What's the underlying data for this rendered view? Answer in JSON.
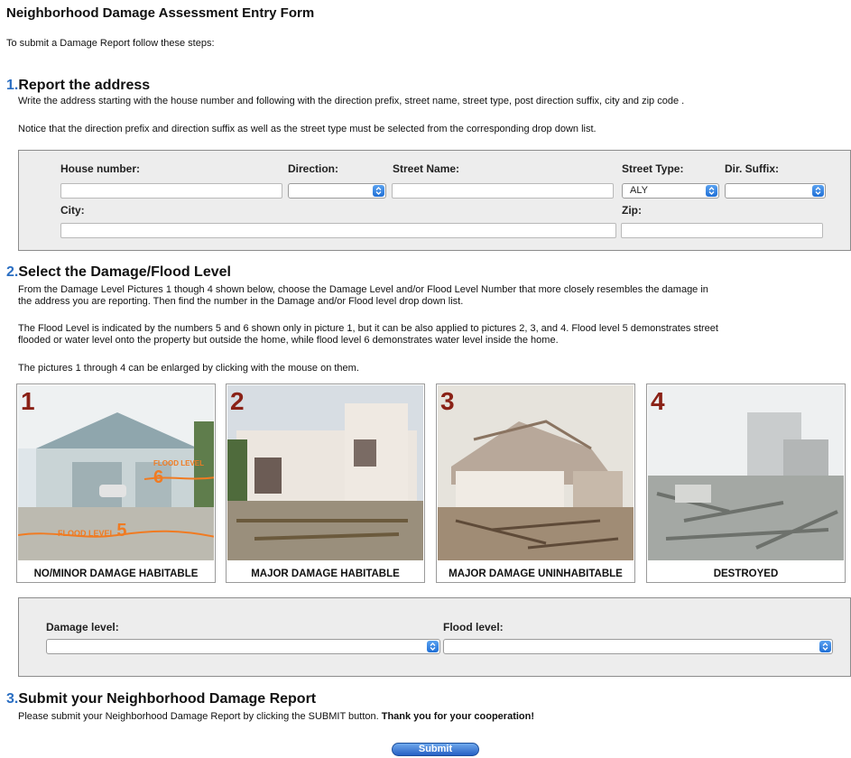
{
  "page_title": "Neighborhood Damage Assessment Entry Form",
  "intro": "To submit a Damage Report follow these steps:",
  "step1": {
    "number": "1.",
    "title": "Report the address",
    "text1": "Write the address starting with the house number and following with the direction prefix, street name, street type, post direction suffix, city and zip code .",
    "text2": "Notice that the direction prefix and direction suffix as well as the street type must be selected from the corresponding drop down list.",
    "fields": {
      "house_number": "House number:",
      "direction": "Direction:",
      "street_name": "Street Name:",
      "street_type": "Street Type:",
      "street_type_value": "ALY",
      "dir_suffix": "Dir. Suffix:",
      "city": "City:",
      "zip": "Zip:"
    }
  },
  "step2": {
    "number": "2.",
    "title": "Select the Damage/Flood Level",
    "text1a": "From the Damage Level Pictures 1 though 4 shown below, choose the Damage Level and/or Flood Level Number that more closely resembles the damage in",
    "text1b": "the address you are reporting. Then find the number in the Damage and/or Flood level drop down list.",
    "text2a": "The Flood Level is indicated by the numbers 5 and 6 shown only in picture 1, but it can be also applied to pictures 2, 3, and 4. Flood level 5 demonstrates street",
    "text2b": "flooded or water level onto the property but outside the home, while flood level 6 demonstrates water level inside the home.",
    "text3": "The pictures 1 through 4 can be enlarged by clicking with the mouse on them.",
    "pictures": [
      {
        "num": "1",
        "caption": "NO/MINOR DAMAGE HABITABLE",
        "flood5": "FLOOD LEVEL",
        "flood5_num": "5",
        "flood6": "FLOOD LEVEL",
        "flood6_num": "6"
      },
      {
        "num": "2",
        "caption": "MAJOR DAMAGE HABITABLE"
      },
      {
        "num": "3",
        "caption": "MAJOR DAMAGE UNINHABITABLE"
      },
      {
        "num": "4",
        "caption": "DESTROYED"
      }
    ],
    "damage_level": "Damage level:",
    "flood_level": "Flood level:"
  },
  "step3": {
    "number": "3.",
    "title": "Submit your Neighborhood Damage Report",
    "text": "Please submit your Neighborhood Damage Report by clicking the SUBMIT button.",
    "thanks": "Thank you for your cooperation!",
    "submit": "Submit"
  }
}
